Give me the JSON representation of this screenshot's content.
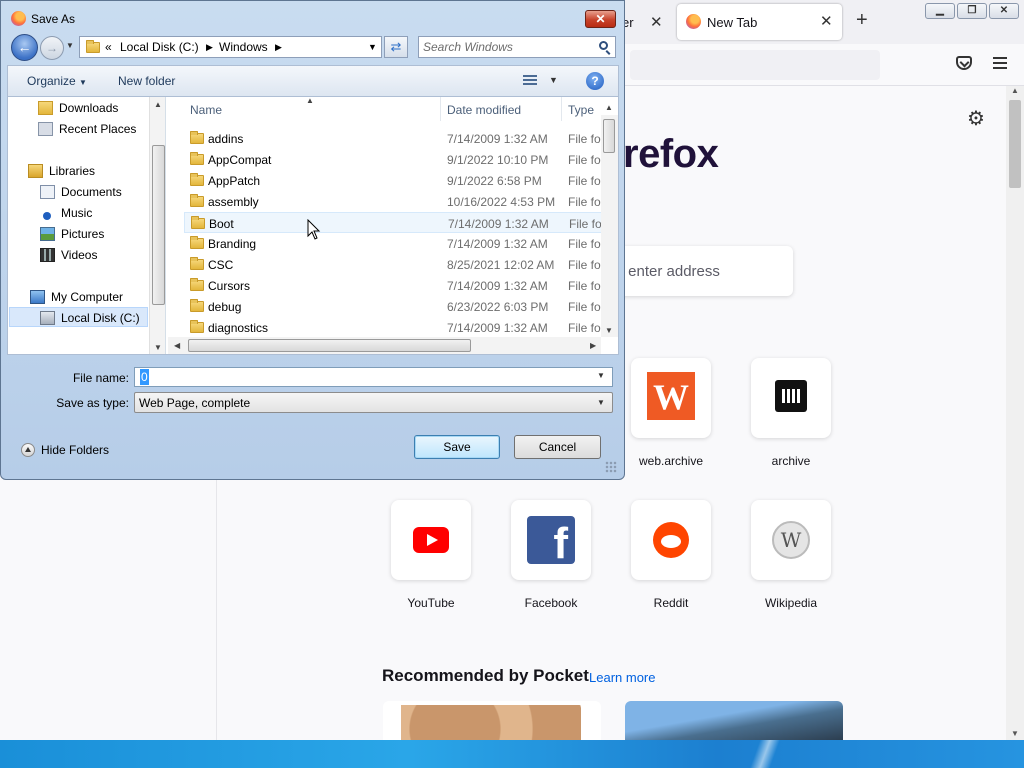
{
  "firefox": {
    "tab_partial_label": "er",
    "tab_active_label": "New Tab",
    "brand_text": "refox",
    "search_placeholder": "r enter address",
    "top_sites": [
      {
        "label": "web.archive",
        "icon": "web-archive-icon"
      },
      {
        "label": "archive",
        "icon": "archive-icon"
      },
      {
        "label": "YouTube",
        "icon": "youtube-icon"
      },
      {
        "label": "Facebook",
        "icon": "facebook-icon"
      },
      {
        "label": "Reddit",
        "icon": "reddit-icon"
      },
      {
        "label": "Wikipedia",
        "icon": "wikipedia-icon"
      }
    ],
    "pocket_title": "Recommended by Pocket",
    "pocket_link": "Learn more",
    "link_color": "#0061e0"
  },
  "dialog": {
    "title": "Save As",
    "breadcrumb": [
      "Local Disk (C:)",
      "Windows"
    ],
    "search_placeholder": "Search Windows",
    "toolbar": {
      "organize": "Organize",
      "new_folder": "New folder"
    },
    "nav_items": [
      {
        "label": "Downloads",
        "icon": "downloads-folder-icon"
      },
      {
        "label": "Recent Places",
        "icon": "recent-places-icon"
      },
      {
        "label": "Libraries",
        "icon": "libraries-icon"
      },
      {
        "label": "Documents",
        "icon": "documents-icon"
      },
      {
        "label": "Music",
        "icon": "music-icon"
      },
      {
        "label": "Pictures",
        "icon": "pictures-icon"
      },
      {
        "label": "Videos",
        "icon": "videos-icon"
      },
      {
        "label": "My Computer",
        "icon": "computer-icon"
      },
      {
        "label": "Local Disk (C:)",
        "icon": "disk-icon"
      }
    ],
    "columns": {
      "name": "Name",
      "date": "Date modified",
      "type": "Type"
    },
    "files": [
      {
        "name": "addins",
        "date": "7/14/2009 1:32 AM",
        "type": "File fol"
      },
      {
        "name": "AppCompat",
        "date": "9/1/2022 10:10 PM",
        "type": "File fol"
      },
      {
        "name": "AppPatch",
        "date": "9/1/2022 6:58 PM",
        "type": "File fol"
      },
      {
        "name": "assembly",
        "date": "10/16/2022 4:53 PM",
        "type": "File fol"
      },
      {
        "name": "Boot",
        "date": "7/14/2009 1:32 AM",
        "type": "File fol"
      },
      {
        "name": "Branding",
        "date": "7/14/2009 1:32 AM",
        "type": "File fol"
      },
      {
        "name": "CSC",
        "date": "8/25/2021 12:02 AM",
        "type": "File fol"
      },
      {
        "name": "Cursors",
        "date": "7/14/2009 1:32 AM",
        "type": "File fol"
      },
      {
        "name": "debug",
        "date": "6/23/2022 6:03 PM",
        "type": "File fol"
      },
      {
        "name": "diagnostics",
        "date": "7/14/2009 1:32 AM",
        "type": "File fol"
      }
    ],
    "file_name_label": "File name:",
    "file_name_value": "0",
    "save_type_label": "Save as type:",
    "save_type_value": "Web Page, complete",
    "hide_folders": "Hide Folders",
    "save_button": "Save",
    "cancel_button": "Cancel",
    "selection_color": "#3399ff"
  }
}
